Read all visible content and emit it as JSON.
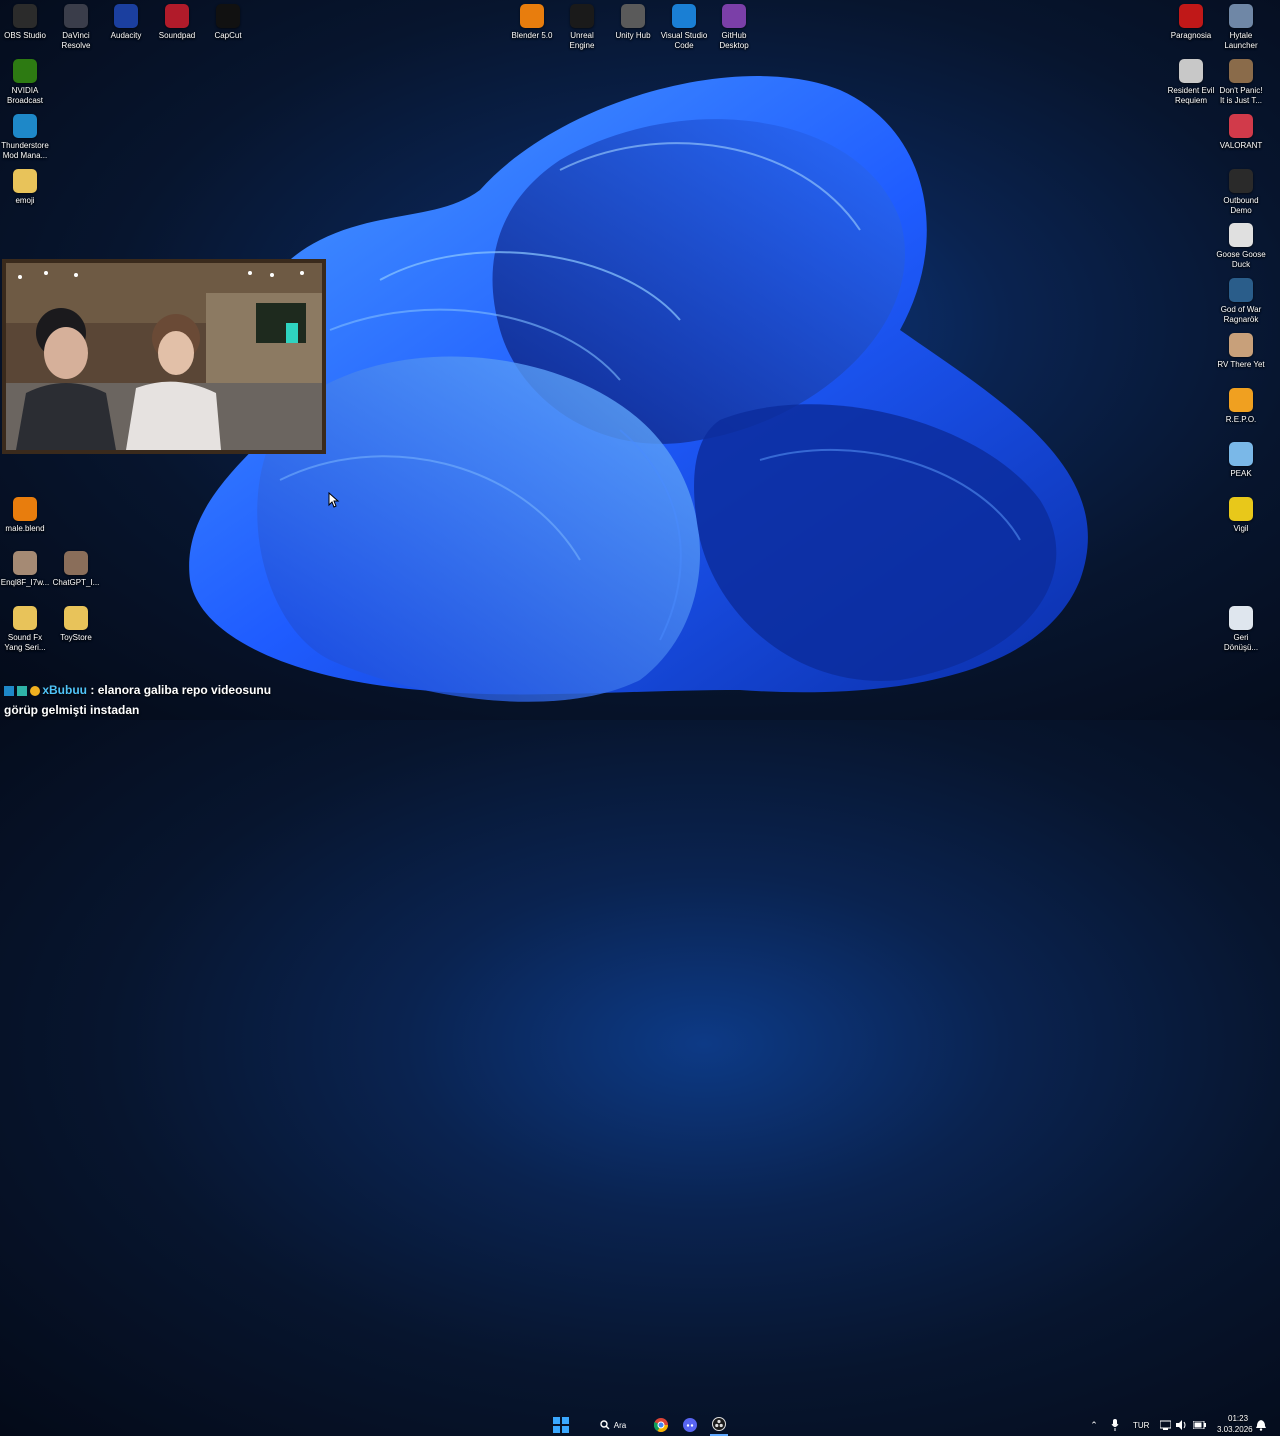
{
  "desktop": {
    "left_column": [
      {
        "label": "OBS Studio",
        "icon": "obs-icon",
        "color": "#2b2b2b"
      },
      {
        "label": "DaVinci\nResolve",
        "icon": "davinci-icon",
        "color": "#3a3d4a"
      },
      {
        "label": "Audacity",
        "icon": "audacity-icon",
        "color": "#1b3f9f"
      },
      {
        "label": "Soundpad",
        "icon": "soundpad-icon",
        "color": "#b11b2a"
      },
      {
        "label": "CapCut",
        "icon": "capcut-icon",
        "color": "#111111"
      },
      {
        "label": "NVIDIA\nBroadcast",
        "icon": "nvidia-icon",
        "color": "#2d7a12"
      },
      {
        "label": "Thunderstore\nMod Mana...",
        "icon": "thunderstore-icon",
        "color": "#1e88c8"
      },
      {
        "label": "emoji",
        "icon": "folder-icon",
        "color": "#e8c35a"
      },
      {
        "label": "male.blend",
        "icon": "blender-file-icon",
        "color": "#e87d0d"
      },
      {
        "label": "Enql8F_I7w...",
        "icon": "image-file-icon",
        "color": "#a58a74"
      },
      {
        "label": "ChatGPT_I...",
        "icon": "image-file-icon",
        "color": "#8a6e5a"
      },
      {
        "label": "Sound Fx\nYang Seri...",
        "icon": "folder-icon",
        "color": "#e8c35a"
      },
      {
        "label": "ToyStore",
        "icon": "folder-icon",
        "color": "#e8c35a"
      }
    ],
    "center_row": [
      {
        "label": "Blender 5.0",
        "icon": "blender-icon",
        "color": "#e87d0d"
      },
      {
        "label": "Unreal\nEngine",
        "icon": "unreal-icon",
        "color": "#1a1a1a"
      },
      {
        "label": "Unity Hub",
        "icon": "unity-icon",
        "color": "#5a5a5a"
      },
      {
        "label": "Visual Studio\nCode",
        "icon": "vscode-icon",
        "color": "#1a7fd4"
      },
      {
        "label": "GitHub\nDesktop",
        "icon": "github-icon",
        "color": "#7b3fa8"
      }
    ],
    "right_column": [
      {
        "label": "Paragnosia",
        "icon": "paragnosia-icon",
        "color": "#c01818"
      },
      {
        "label": "Hytale\nLauncher",
        "icon": "hytale-icon",
        "color": "#6f87a6"
      },
      {
        "label": "Resident Evil\nRequiem",
        "icon": "resident-evil-icon",
        "color": "#c8c8c8"
      },
      {
        "label": "Don't Panic!\nIt is Just T...",
        "icon": "dont-panic-icon",
        "color": "#8a6b4a"
      },
      {
        "label": "VALORANT",
        "icon": "valorant-icon",
        "color": "#d13a4a"
      },
      {
        "label": "Outbound\nDemo",
        "icon": "outbound-icon",
        "color": "#2a2a2a"
      },
      {
        "label": "Goose Goose\nDuck",
        "icon": "goose-icon",
        "color": "#e0e0e0"
      },
      {
        "label": "God of War\nRagnarök",
        "icon": "god-of-war-icon",
        "color": "#2a5d8a"
      },
      {
        "label": "RV There Yet",
        "icon": "rv-icon",
        "color": "#c8a07a"
      },
      {
        "label": "R.E.P.O.",
        "icon": "repo-icon",
        "color": "#f0a020"
      },
      {
        "label": "PEAK",
        "icon": "peak-icon",
        "color": "#7ab8e8"
      },
      {
        "label": "Vigil",
        "icon": "vigil-icon",
        "color": "#e8c81a"
      },
      {
        "label": "Geri\nDönüşü...",
        "icon": "recycle-bin-icon",
        "color": "#dfe6ee"
      }
    ]
  },
  "chat": {
    "username": "xBubuu",
    "separator": " : ",
    "message": "elanora galiba repo videosunu görüp gelmişti instadan"
  },
  "taskbar": {
    "search_label": "Ara",
    "language": "TUR",
    "time": "01:23",
    "date": "3.03.2026"
  },
  "colors": {
    "wallpaper_accent": "#1f5cff",
    "taskbar_bg": "#0a1226"
  }
}
